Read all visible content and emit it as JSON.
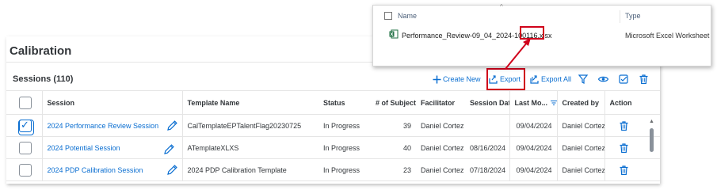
{
  "page": {
    "title": "Calibration"
  },
  "sessions": {
    "title": "Sessions (110)",
    "toolbar": {
      "create_new": "Create New",
      "export": "Export",
      "export_all": "Export All"
    }
  },
  "table": {
    "headers": {
      "session": "Session",
      "template_name": "Template Name",
      "status": "Status",
      "num_subjects": "# of Subjects",
      "facilitator": "Facilitator",
      "session_date": "Session Date",
      "last_modified": "Last Mo...",
      "created_by": "Created by",
      "action": "Action"
    },
    "rows": [
      {
        "selected": true,
        "session": "2024 Performance Review Session",
        "template_name": "CalTemplateEPTalentFlag20230725",
        "status": "In Progress",
        "num_subjects": "39",
        "facilitator": "Daniel Cortez",
        "session_date": "",
        "last_modified": "09/04/2024",
        "created_by": "Daniel Cortez"
      },
      {
        "selected": false,
        "session": "2024 Potential Session",
        "template_name": "ATemplateXLXS",
        "status": "In Progress",
        "num_subjects": "40",
        "facilitator": "Daniel Cortez",
        "session_date": "08/16/2024",
        "last_modified": "09/04/2024",
        "created_by": "Daniel Cortez"
      },
      {
        "selected": false,
        "session": "2024 PDP Calibration Session",
        "template_name": "2024 PDP Calibration Template",
        "status": "In Progress",
        "num_subjects": "23",
        "facilitator": "Daniel Cortez",
        "session_date": "07/18/2024",
        "last_modified": "09/04/2024",
        "created_by": "Daniel Cortez"
      }
    ]
  },
  "explorer": {
    "header": {
      "name": "Name",
      "type": "Type"
    },
    "file": {
      "name": "Performance_Review-09_04_2024-100116.xlsx",
      "type": "Microsoft Excel Worksheet",
      "icon": "excel-file-icon"
    }
  },
  "colors": {
    "accent": "#0a6ed1",
    "highlight": "#d0021b",
    "excel": "#1d6f42"
  }
}
